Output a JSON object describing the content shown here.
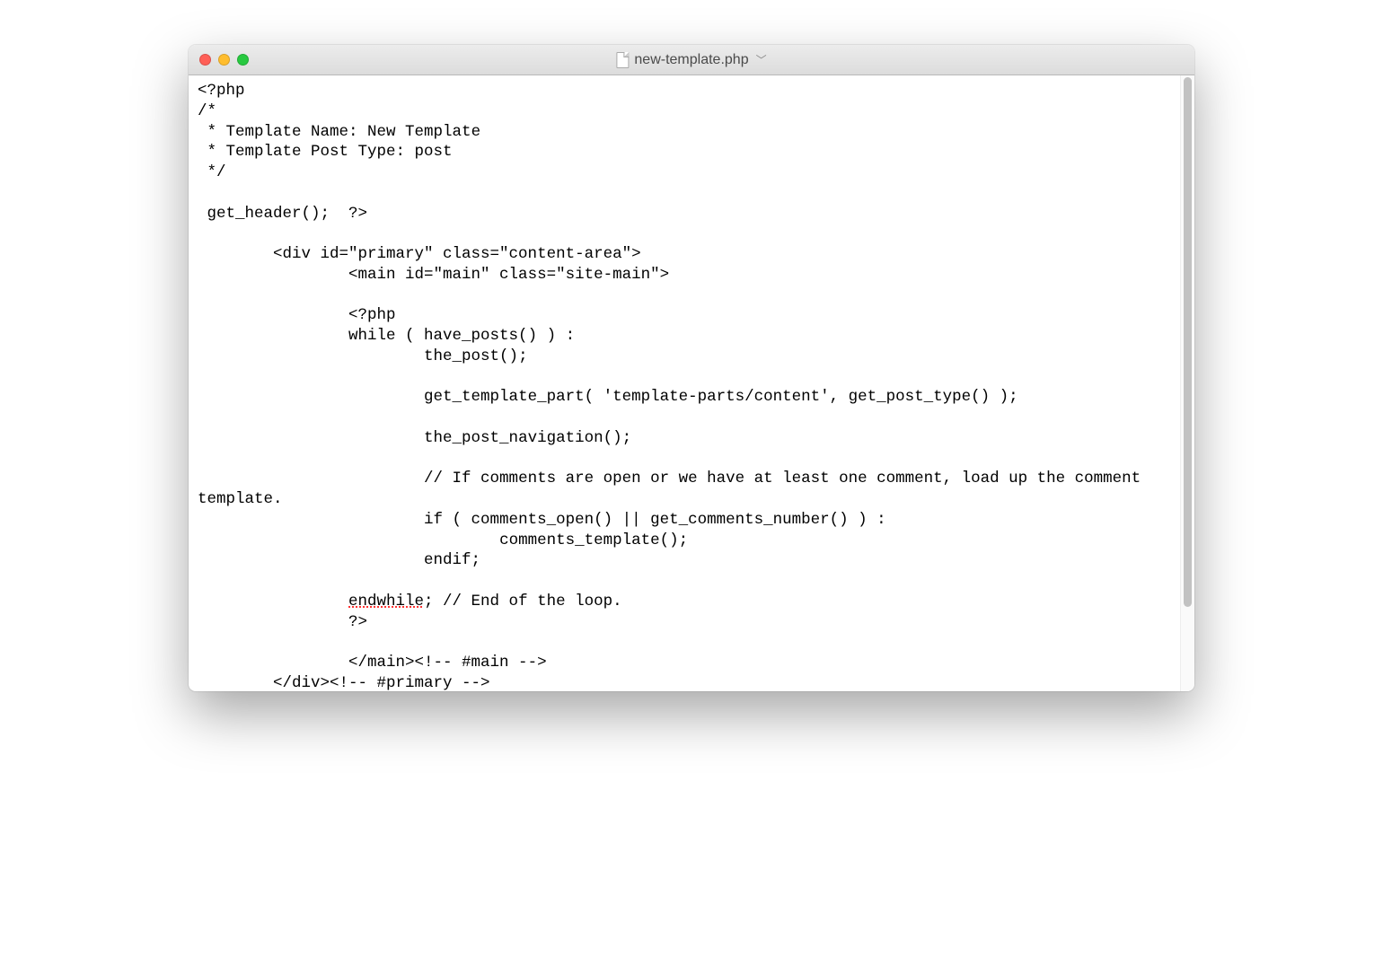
{
  "window": {
    "title": "new-template.php"
  },
  "code": {
    "l01": "<?php",
    "l02": "/*",
    "l03": " * Template Name: New Template",
    "l04": " * Template Post Type: post",
    "l05": " */",
    "l06": " ",
    "l07": " get_header();  ?>",
    "l08": "",
    "l09": "        <div id=\"primary\" class=\"content-area\">",
    "l10": "                <main id=\"main\" class=\"site-main\">",
    "l11": "",
    "l12": "                <?php",
    "l13": "                while ( have_posts() ) :",
    "l14": "                        the_post();",
    "l15": "",
    "l16": "                        get_template_part( 'template-parts/content', get_post_type() );",
    "l17": "",
    "l18": "                        the_post_navigation();",
    "l19": "",
    "l20": "                        // If comments are open or we have at least one comment, load up the comment template.",
    "l21": "                        if ( comments_open() || get_comments_number() ) :",
    "l22": "                                comments_template();",
    "l23": "                        endif;",
    "l24": "",
    "l25a": "                ",
    "l25b": "endwhile",
    "l25c": "; // End of the loop.",
    "l26": "                ?>",
    "l27": "",
    "l28": "                </main><!-- #main -->",
    "l29": "        </div><!-- #primary -->"
  }
}
